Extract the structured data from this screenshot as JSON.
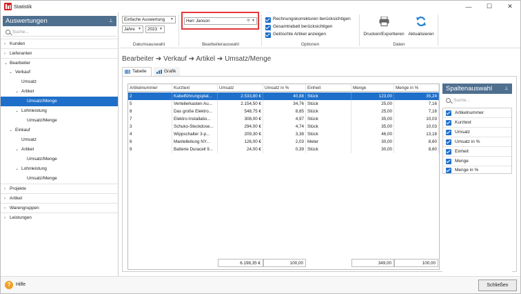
{
  "window": {
    "title": "Statistik",
    "minimize": "—",
    "maximize": "☐",
    "close": "✕"
  },
  "colors": {
    "accent": "#1e6fc9",
    "panel_header": "#4f6f8f",
    "highlight_box": "#e53535",
    "help_icon": "#f0a020"
  },
  "sidebar": {
    "title": "Auswertungen",
    "pin": "⊥",
    "search_placeholder": "Suche...",
    "items": [
      {
        "label": "Kunden",
        "arrow": "›"
      },
      {
        "label": "Lieferanten",
        "arrow": "›"
      },
      {
        "label": "Bearbeiter",
        "arrow": "⌄"
      },
      {
        "label": "Verkauf",
        "arrow": "⌄"
      },
      {
        "label": "Umsatz",
        "arrow": ""
      },
      {
        "label": "Artikel",
        "arrow": "⌄"
      },
      {
        "label": "Umsatz/Menge",
        "arrow": ""
      },
      {
        "label": "Lohnleistung",
        "arrow": "⌄"
      },
      {
        "label": "Umsatz/Menge",
        "arrow": ""
      },
      {
        "label": "Einkauf",
        "arrow": "⌄"
      },
      {
        "label": "Umsatz",
        "arrow": ""
      },
      {
        "label": "Artikel",
        "arrow": "⌄"
      },
      {
        "label": "Umsatz/Menge",
        "arrow": ""
      },
      {
        "label": "Lohnleistung",
        "arrow": "⌄"
      },
      {
        "label": "Umsatz/Menge",
        "arrow": ""
      },
      {
        "label": "Projekte",
        "arrow": "›"
      },
      {
        "label": "Artikel",
        "arrow": "›"
      },
      {
        "label": "Warengruppen",
        "arrow": "›"
      },
      {
        "label": "Leistungen",
        "arrow": "›"
      }
    ]
  },
  "ribbon": {
    "evaluation_type": "Einfache Auswertung",
    "period_type": "Jahre",
    "year": "2023",
    "group_date": "Datumsauswahl",
    "editor_value": "Herr Janson",
    "group_editor": "Bearbeiterauswahl",
    "options": [
      "Rechnungskorrekturen berücksichtigen",
      "Gesamtrabatt berücksichtigen",
      "Gelöschte Artikel anzeigen"
    ],
    "group_options": "Optionen",
    "print_export": "Drucken/Exportieren",
    "refresh": "Aktualisieren",
    "group_data": "Daten"
  },
  "breadcrumb": "Bearbeiter ➔ Verkauf ➔ Artikel ➔ Umsatz/Menge",
  "tabs": [
    {
      "label": "Tabelle"
    },
    {
      "label": "Grafik"
    }
  ],
  "table": {
    "columns": [
      "Artikelnummer",
      "Kurztext",
      "Umsatz",
      "Umsatz in %",
      "Einheit",
      "Menge",
      "Menge in %"
    ],
    "rows": [
      [
        "2",
        "Kabelführungsplat...",
        "2.533,80 €",
        "40,88",
        "Stück",
        "123,00",
        "35,24"
      ],
      [
        "5",
        "Verteilerkasten Au...",
        "2.154,50 €",
        "34,76",
        "Stück",
        "25,00",
        "7,16"
      ],
      [
        "8",
        "Das große Elektro...",
        "548,75 €",
        "8,85",
        "Stück",
        "25,00",
        "7,16"
      ],
      [
        "7",
        "Elektro-Installatio...",
        "308,00 €",
        "4,97",
        "Stück",
        "35,00",
        "10,03"
      ],
      [
        "3",
        "Schuko-Steckdose...",
        "294,00 €",
        "4,74",
        "Stück",
        "35,00",
        "10,03"
      ],
      [
        "4",
        "Wippschalter 3-p...",
        "209,30 €",
        "3,38",
        "Stück",
        "46,00",
        "13,18"
      ],
      [
        "6",
        "Mantelleitung NY...",
        "126,00 €",
        "2,03",
        "Meter",
        "30,00",
        "8,60"
      ],
      [
        "9",
        "Batterie Duracell 9...",
        "24,00 €",
        "0,39",
        "Stück",
        "30,00",
        "8,60"
      ]
    ],
    "totals": {
      "umsatz": "6.198,35 €",
      "umsatz_pct": "100,00",
      "menge": "349,00",
      "menge_pct": "100,00"
    }
  },
  "column_panel": {
    "title": "Spaltenauswahl",
    "pin": "⊥",
    "search_placeholder": "Suche...",
    "items": [
      "Artikelnummer",
      "Kurztext",
      "Umsatz",
      "Umsatz in %",
      "Einheit",
      "Menge",
      "Menge in %"
    ]
  },
  "footer": {
    "help": "Hilfe",
    "help_icon": "?",
    "close": "Schließen"
  }
}
